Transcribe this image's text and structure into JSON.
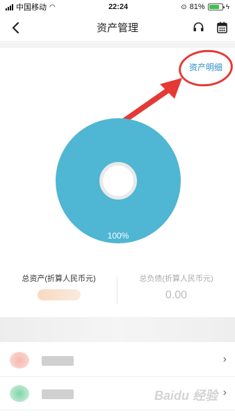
{
  "status_bar": {
    "carrier": "中国移动",
    "time": "22:24",
    "battery": "81%",
    "battery_level": 0.81
  },
  "nav": {
    "title": "资产管理"
  },
  "link": {
    "asset_detail": "资产明细"
  },
  "chart_data": {
    "type": "pie",
    "values": [
      100
    ],
    "labels": [
      "100%"
    ],
    "colors": [
      "#4fb6d3"
    ]
  },
  "summary": {
    "total_assets_label": "总资产(折算人民币元)",
    "total_liabilities_label": "总负债(折算人民币元)",
    "total_liabilities_value": "0.00"
  },
  "list": [
    {
      "chevron": "›",
      "icon_color": "#f4a6a0"
    },
    {
      "chevron": "›",
      "icon_color": "#7cd3a7"
    }
  ],
  "watermark": {
    "text": "Baidu 经验"
  }
}
